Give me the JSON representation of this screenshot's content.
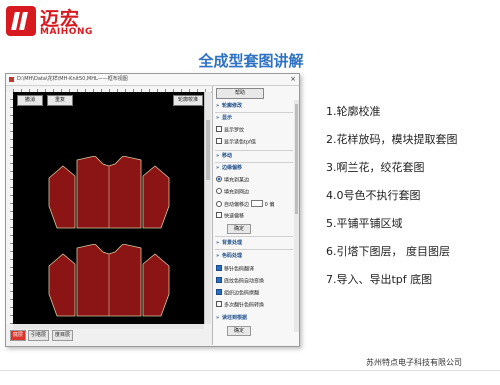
{
  "logo": {
    "cn": "迈宏",
    "en": "MAIHONG"
  },
  "slide_title": "全成型套图讲解",
  "window": {
    "title": "D:\\MH\\Data\\花样\\MH-Knit50,MHL——框布视图",
    "close_glyph": "×"
  },
  "canvas": {
    "undo_label": "撤消",
    "redo_label": "重复",
    "contour_label": "轮廓校准"
  },
  "bottom_tabs": [
    {
      "label": "底层"
    },
    {
      "label": "引塔层"
    },
    {
      "label": "度目层"
    }
  ],
  "panel": {
    "help_label": "帮助",
    "section_contour": "轮廓修改",
    "section_display": "显示",
    "display_options": [
      "显示罗纹",
      "显示读色tpf值"
    ],
    "section_move": "移动",
    "section_edge": "边缘偏移",
    "edge_options": [
      "填充到某边",
      "填充到网边",
      "自动偏移边"
    ],
    "edge_unit": "偏",
    "edge_value": "0",
    "quick_label": "快速偏移",
    "confirm_label": "确定",
    "section_bg": "背景处理",
    "section_color": "色码处理",
    "color_options": [
      "移针色码翻译",
      "底纹色码自动变换",
      "组织边色码撰翻",
      "多次翻针色码转换"
    ],
    "section_tail": "读坯到根据",
    "bottom_confirm": "确定"
  },
  "features": [
    "1.轮廓校准",
    "2.花样放码，模块提取套图",
    "3.啊兰花，绞花套图",
    "4.0号色不执行套图",
    "5.平铺平铺区域",
    "6.引塔下图层， 度目图层",
    "7.导入、导出tpf  底图"
  ],
  "company": "苏州特点电子科技有限公司",
  "colors": {
    "brand_red": "#d71920",
    "title_blue": "#2f72c4",
    "garment_red": "#8b1414",
    "garment_outline": "#d9c9a0"
  }
}
